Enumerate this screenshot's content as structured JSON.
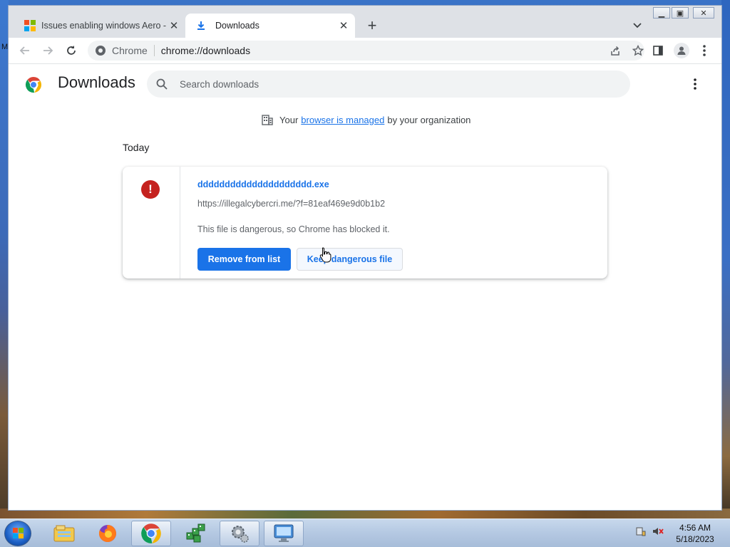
{
  "desktop": {
    "edge_text": "M"
  },
  "browser": {
    "tabs": [
      {
        "label": "Issues enabling windows Aero - M",
        "active": false
      },
      {
        "label": "Downloads",
        "active": true
      }
    ],
    "omnibox": {
      "site_label": "Chrome",
      "url": "chrome://downloads"
    }
  },
  "downloads_page": {
    "title": "Downloads",
    "search": {
      "placeholder": "Search downloads"
    },
    "managed": {
      "prefix": "Your",
      "link": "browser is managed",
      "suffix": "by your organization"
    },
    "section_label": "Today",
    "item": {
      "file_name": "ddddddddddddddddddddd.exe",
      "url": "https://illegalcybercri.me/?f=81eaf469e9d0b1b2",
      "message": "This file is dangerous, so Chrome has blocked it.",
      "remove_button": "Remove from list",
      "keep_button": "Keep dangerous file"
    }
  },
  "taskbar": {
    "apps": [
      "windows-explorer",
      "firefox",
      "chrome",
      "network-app",
      "settings-app",
      "remote-desktop-app"
    ],
    "clock": {
      "time": "4:56 AM",
      "date": "5/18/2023"
    }
  },
  "colors": {
    "accent": "#1a73e8",
    "danger": "#c5221f",
    "tab_strip": "#dee1e6"
  }
}
